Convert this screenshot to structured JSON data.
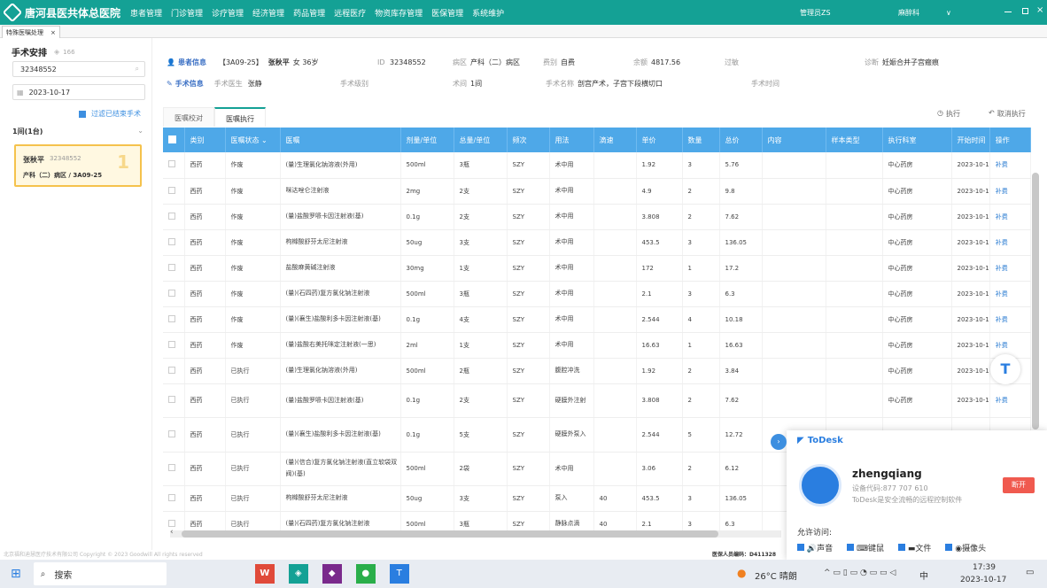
{
  "app": {
    "title": "唐河县医共体总医院",
    "nav": [
      "患者管理",
      "门诊管理",
      "诊疗管理",
      "经济管理",
      "药品管理",
      "远程医疗",
      "物资库存管理",
      "医保管理",
      "系统维护"
    ],
    "user": "管理员ZS",
    "dept": "麻醉科",
    "dept_arrow": "∨"
  },
  "tab": {
    "label": "特殊医嘱处理",
    "close": "×"
  },
  "left": {
    "title": "手术安排",
    "count": "166",
    "search_value": "32348552",
    "date_value": "2023-10-17",
    "filter_label": "过滤已结束手术",
    "room_label": "1间(1台)",
    "card": {
      "name": "张秋平",
      "id": "32348552",
      "ward": "产科（二）病区 / 3A09-25",
      "seq": "1"
    }
  },
  "patient": {
    "section_label": "患者信息",
    "bed": "【3A09-25】",
    "name": "张秋平",
    "gender_age": "女 36岁",
    "id_label": "ID",
    "id": "32348552",
    "ward_label": "病区",
    "ward": "产科（二）病区",
    "fee_type_label": "费别",
    "fee_type": "自费",
    "balance_label": "余额",
    "balance": "4817.56",
    "allergy_label": "过敏",
    "diag_label": "诊断",
    "diag": "妊娠合并子宫瘢痕"
  },
  "surgery": {
    "section_label": "手术信息",
    "doctor_label": "手术医生",
    "doctor": "张静",
    "level_label": "手术级别",
    "room_label": "术间",
    "room": "1间",
    "name_label": "手术名称",
    "name": "剖宫产术，子宫下段横切口",
    "time_label": "手术时间"
  },
  "subtabs": [
    "医嘱校对",
    "医嘱执行"
  ],
  "actions": {
    "execute": "执行",
    "cancel": "取消执行"
  },
  "columns": [
    "类别",
    "医嘱状态",
    "医嘱",
    "剂量/单位",
    "总量/单位",
    "频次",
    "用法",
    "滴速",
    "单价",
    "数量",
    "总价",
    "内容",
    "样本类型",
    "执行科室",
    "开始时间",
    "操作"
  ],
  "rows": [
    [
      "西药",
      "作废",
      "(量)生理氯化钠溶液(外用)",
      "500ml",
      "3瓶",
      "SZY",
      "术中用",
      "",
      "1.92",
      "3",
      "5.76",
      "",
      "",
      "中心药房",
      "2023-10-1",
      "补费"
    ],
    [
      "西药",
      "作废",
      "咪达唑仑注射液",
      "2mg",
      "2支",
      "SZY",
      "术中用",
      "",
      "4.9",
      "2",
      "9.8",
      "",
      "",
      "中心药房",
      "2023-10-1",
      "补费"
    ],
    [
      "西药",
      "作废",
      "(量)盐酸罗哌卡因注射液(基)",
      "0.1g",
      "2支",
      "SZY",
      "术中用",
      "",
      "3.808",
      "2",
      "7.62",
      "",
      "",
      "中心药房",
      "2023-10-1",
      "补费"
    ],
    [
      "西药",
      "作废",
      "枸橼酸舒芬太尼注射液",
      "50ug",
      "3支",
      "SZY",
      "术中用",
      "",
      "453.5",
      "3",
      "136.05",
      "",
      "",
      "中心药房",
      "2023-10-1",
      "补费"
    ],
    [
      "西药",
      "作废",
      "盐酸麻黄碱注射液",
      "30mg",
      "1支",
      "SZY",
      "术中用",
      "",
      "172",
      "1",
      "17.2",
      "",
      "",
      "中心药房",
      "2023-10-1",
      "补费"
    ],
    [
      "西药",
      "作废",
      "(量)(石四药)复方氯化钠注射液",
      "500ml",
      "3瓶",
      "SZY",
      "术中用",
      "",
      "2.1",
      "3",
      "6.3",
      "",
      "",
      "中心药房",
      "2023-10-1",
      "补费"
    ],
    [
      "西药",
      "作废",
      "(量)(襄生)盐酸利多卡因注射液(基)",
      "0.1g",
      "4支",
      "SZY",
      "术中用",
      "",
      "2.544",
      "4",
      "10.18",
      "",
      "",
      "中心药房",
      "2023-10-1",
      "补费"
    ],
    [
      "西药",
      "作废",
      "(量)盐酸右美托咪定注射液(一思)",
      "2ml",
      "1支",
      "SZY",
      "术中用",
      "",
      "16.63",
      "1",
      "16.63",
      "",
      "",
      "中心药房",
      "2023-10-1",
      "补费"
    ],
    [
      "西药",
      "已执行",
      "(量)生理氯化钠溶液(外用)",
      "500ml",
      "2瓶",
      "SZY",
      "腹腔冲洗",
      "",
      "1.92",
      "2",
      "3.84",
      "",
      "",
      "中心药房",
      "2023-10-1",
      "补费"
    ],
    [
      "西药",
      "已执行",
      "(量)盐酸罗哌卡因注射液(基)",
      "0.1g",
      "2支",
      "SZY",
      "硬膜外注射",
      "",
      "3.808",
      "2",
      "7.62",
      "",
      "",
      "中心药房",
      "2023-10-1",
      "补费"
    ],
    [
      "西药",
      "已执行",
      "(量)(襄生)盐酸利多卡因注射液(基)",
      "0.1g",
      "5支",
      "SZY",
      "硬膜外泵入",
      "",
      "2.544",
      "5",
      "12.72",
      "",
      "",
      "",
      "",
      ""
    ],
    [
      "西药",
      "已执行",
      "(量)(信合)复方氯化钠注射液(直立软袋双阀)(基)",
      "500ml",
      "2袋",
      "SZY",
      "术中用",
      "",
      "3.06",
      "2",
      "6.12",
      "",
      "",
      "",
      "",
      ""
    ],
    [
      "西药",
      "已执行",
      "枸橼酸舒芬太尼注射液",
      "50ug",
      "3支",
      "SZY",
      "泵入",
      "40",
      "453.5",
      "3",
      "136.05",
      "",
      "",
      "",
      "",
      ""
    ],
    [
      "西药",
      "已执行",
      "(量)(石四药)复方氯化钠注射液",
      "500ml",
      "3瓶",
      "SZY",
      "静脉点滴",
      "40",
      "2.1",
      "3",
      "6.3",
      "",
      "",
      "",
      "",
      ""
    ]
  ],
  "statusbar": {
    "copyright": "北京福和迪慧医疗技术有限公司 Copyright © 2023 Goodwill All rights reserved",
    "right": "医保人员编码：D411328"
  },
  "todesk": {
    "brand": "ToDesk",
    "user": "zhengqiang",
    "device": "设备代码:877 707 610",
    "desc": "ToDesk是安全流畅的远程控制软件",
    "disconnect": "断开",
    "allow_label": "允许访问:",
    "perms": [
      "声音",
      "键鼠",
      "文件",
      "摄像头"
    ]
  },
  "taskbar": {
    "search": "搜索",
    "weather": "26°C 晴朗",
    "ime": "中",
    "time": "17:39",
    "date": "2023-10-17"
  },
  "colors": {
    "brand": "#14a195",
    "header": "#4ea8e8",
    "link": "#2f7fd3",
    "danger": "#f05a4f"
  }
}
